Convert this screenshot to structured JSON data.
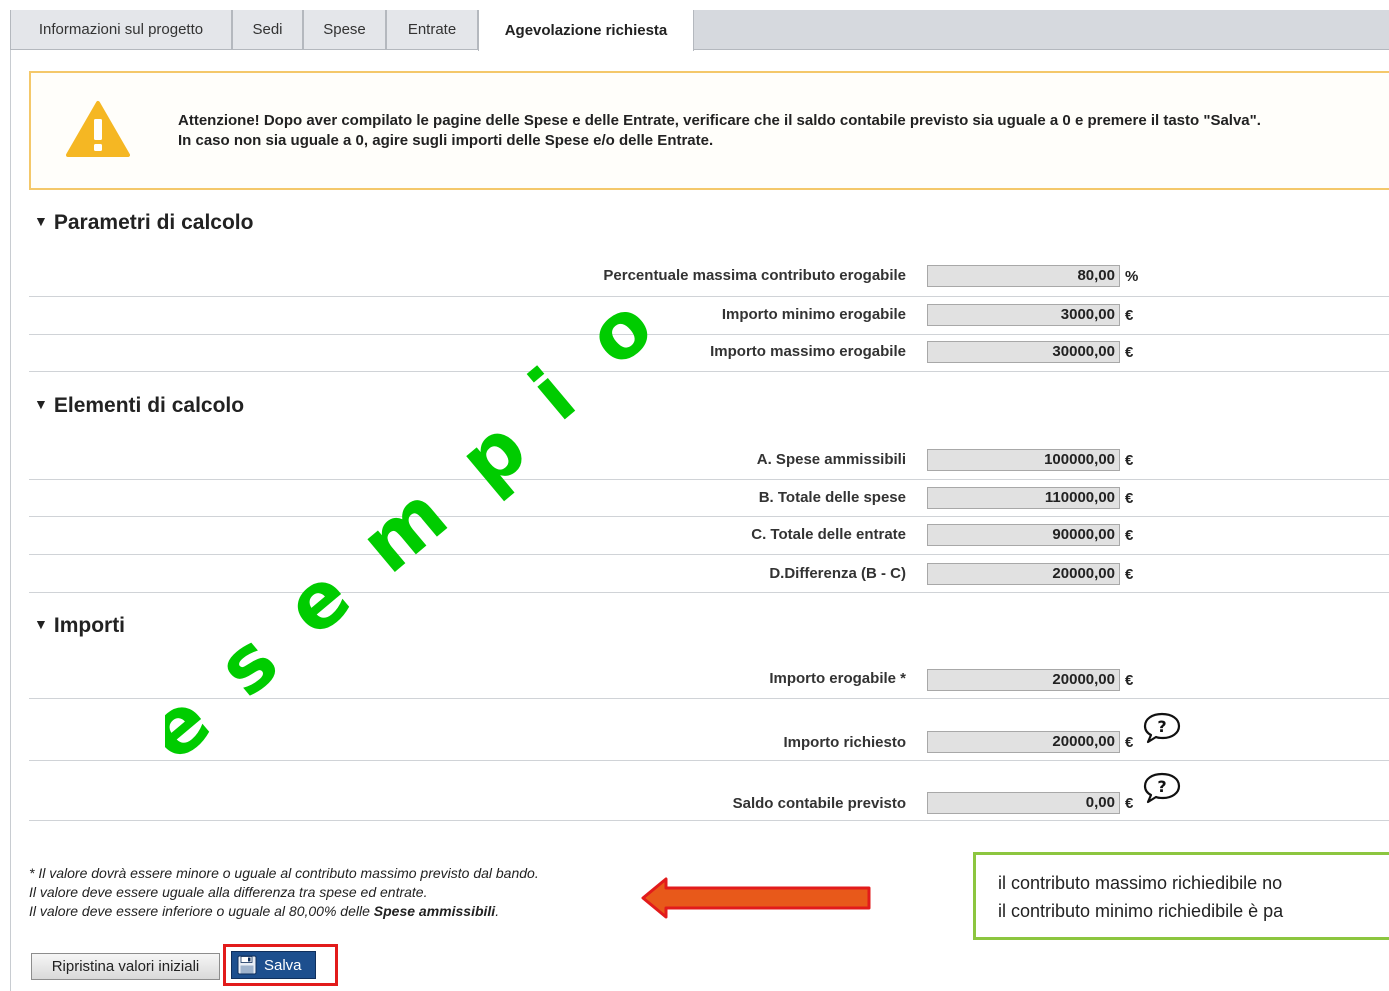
{
  "tabs": [
    {
      "label": "Informazioni sul progetto",
      "active": false
    },
    {
      "label": "Sedi",
      "active": false
    },
    {
      "label": "Spese",
      "active": false
    },
    {
      "label": "Entrate",
      "active": false
    },
    {
      "label": "Agevolazione richiesta",
      "active": true
    }
  ],
  "alert": {
    "icon": "warning-icon",
    "line1": "Attenzione! Dopo aver compilato le pagine delle Spese e delle Entrate, verificare che il saldo contabile previsto sia uguale a 0 e premere il tasto \"Salva\".",
    "line2": "In caso non sia uguale a 0, agire sugli importi delle Spese e/o delle Entrate."
  },
  "parametri": {
    "title": "Parametri di calcolo",
    "rows": [
      {
        "label": "Percentuale massima contributo erogabile",
        "value": "80,00",
        "unit": "%"
      },
      {
        "label": "Importo minimo erogabile",
        "value": "3000,00",
        "unit": "€"
      },
      {
        "label": "Importo massimo erogabile",
        "value": "30000,00",
        "unit": "€"
      }
    ]
  },
  "elementi": {
    "title": "Elementi di calcolo",
    "rows": [
      {
        "label": "A. Spese ammissibili",
        "value": "100000,00",
        "unit": "€"
      },
      {
        "label": "B. Totale delle spese",
        "value": "110000,00",
        "unit": "€"
      },
      {
        "label": "C. Totale delle entrate",
        "value": "90000,00",
        "unit": "€"
      },
      {
        "label": "D.Differenza (B - C)",
        "value": "20000,00",
        "unit": "€"
      }
    ]
  },
  "importi": {
    "title": "Importi",
    "rows": [
      {
        "label": "Importo erogabile *",
        "value": "20000,00",
        "unit": "€"
      },
      {
        "label": "Importo richiesto",
        "value": "20000,00",
        "unit": "€",
        "help_icon": "question-bubble-icon"
      },
      {
        "label": "Saldo contabile previsto",
        "value": "0,00",
        "unit": "€",
        "help_icon": "question-bubble-icon"
      }
    ]
  },
  "notes": {
    "line1": "* Il valore dovrà essere minore o uguale al contributo massimo previsto dal bando.",
    "line2": "Il valore deve essere uguale alla differenza tra spese ed entrate.",
    "line3_prefix": "Il valore deve essere inferiore o uguale al 80,00% delle ",
    "line3_bold": "Spese ammissibili",
    "line3_suffix": "."
  },
  "buttons": {
    "reset_label": "Ripristina valori iniziali",
    "save_label": "Salva"
  },
  "annotation": {
    "line1": "il contributo massimo richiedibile no",
    "line2": "il contributo minimo richiedibile è pa"
  },
  "watermark": {
    "text": "esempio",
    "color": "#00cc00"
  },
  "colors": {
    "alert_border": "#f4c86a",
    "warning_icon": "#f5b723",
    "save_button": "#1d4f8e",
    "highlight_red": "#e21b1b",
    "arrow_orange": "#e8591a",
    "note_border": "#8cc63f"
  }
}
